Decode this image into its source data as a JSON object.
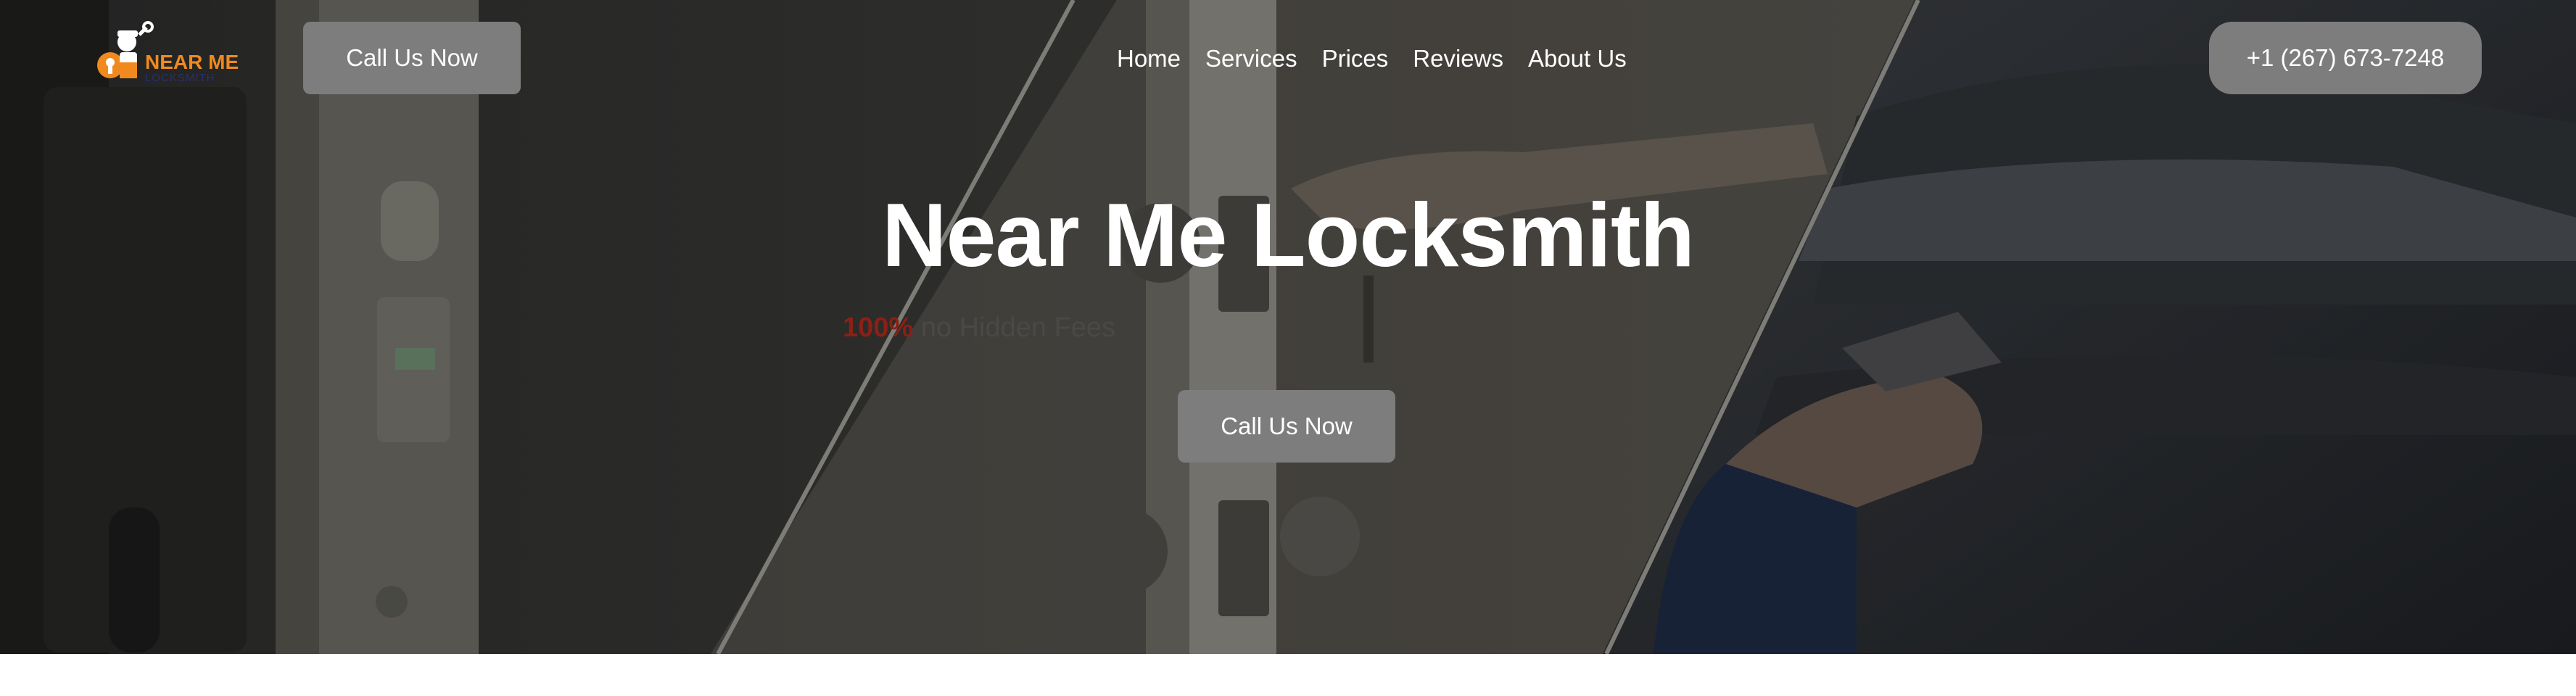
{
  "header": {
    "logo": {
      "text_top": "NEAR ME",
      "text_bottom": "LOCKSMITH",
      "icon": "locksmith-mascot-icon"
    },
    "call_button_label": "Call Us Now",
    "nav": [
      {
        "label": "Home"
      },
      {
        "label": "Services"
      },
      {
        "label": "Prices"
      },
      {
        "label": "Reviews"
      },
      {
        "label": "About Us"
      }
    ],
    "phone_button_label": "+1 (267) 673-7248"
  },
  "hero": {
    "title": "Near Me Locksmith",
    "tagline_highlight": "100%",
    "tagline_rest": " no Hidden Fees",
    "cta_label": "Call Us Now",
    "background": "door-lock-and-car-key-photo"
  },
  "colors": {
    "button_bg": "#7d7d7d",
    "tagline_highlight": "#8a2016",
    "logo_orange": "#f08a1e",
    "logo_navy": "#2a2f6e",
    "page_bg": "#ffffff"
  }
}
